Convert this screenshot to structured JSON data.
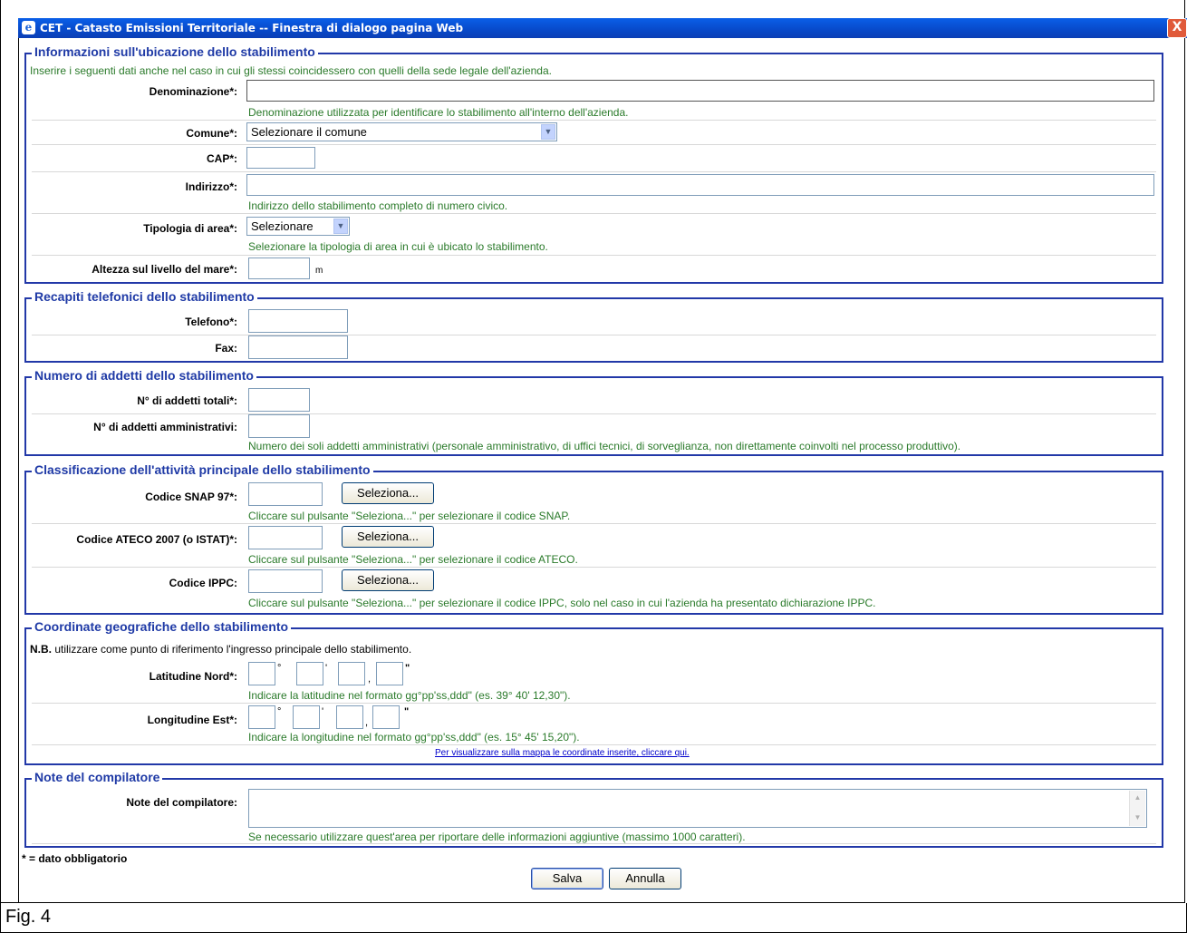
{
  "window": {
    "title": "CET - Catasto Emissioni Territoriale -- Finestra di dialogo pagina Web",
    "close_glyph": "X",
    "ie_glyph": "e"
  },
  "sec1": {
    "legend": "Informazioni sull'ubicazione dello stabilimento",
    "intro": "Inserire i seguenti dati anche nel caso in cui gli stessi coincidessero con quelli della sede legale dell'azienda.",
    "denominazione_label": "Denominazione*:",
    "denominazione_hint": "Denominazione utilizzata per identificare lo stabilimento all'interno dell'azienda.",
    "comune_label": "Comune*:",
    "comune_value": "Selezionare il comune",
    "cap_label": "CAP*:",
    "indirizzo_label": "Indirizzo*:",
    "indirizzo_hint": "Indirizzo dello stabilimento completo di numero civico.",
    "tipologia_label": "Tipologia di area*:",
    "tipologia_value": "Selezionare",
    "tipologia_hint": "Selezionare la tipologia di area in cui è ubicato lo stabilimento.",
    "altezza_label": "Altezza sul livello del mare*:",
    "altezza_unit": "m"
  },
  "sec2": {
    "legend": "Recapiti telefonici dello stabilimento",
    "telefono_label": "Telefono*:",
    "fax_label": "Fax:"
  },
  "sec3": {
    "legend": "Numero di addetti dello stabilimento",
    "totali_label": "N° di addetti totali*:",
    "amm_label": "N° di addetti amministrativi:",
    "amm_hint": "Numero dei soli addetti amministrativi (personale amministrativo, di uffici tecnici, di sorveglianza, non direttamente coinvolti nel processo produttivo)."
  },
  "sec4": {
    "legend": "Classificazione dell'attività principale dello stabilimento",
    "snap_label": "Codice SNAP 97*:",
    "snap_hint": "Cliccare sul pulsante \"Seleziona...\" per selezionare il codice SNAP.",
    "ateco_label": "Codice ATECO 2007 (o ISTAT)*:",
    "ateco_hint": "Cliccare sul pulsante \"Seleziona...\" per selezionare il codice ATECO.",
    "ippc_label": "Codice IPPC:",
    "ippc_hint": "Cliccare sul pulsante \"Seleziona...\" per selezionare il codice IPPC, solo nel caso in cui l'azienda ha presentato dichiarazione IPPC.",
    "button_label": "Seleziona..."
  },
  "sec5": {
    "legend": "Coordinate geografiche dello stabilimento",
    "nb_bold": "N.B.",
    "nb_text": " utilizzare come punto di riferimento l'ingresso principale dello stabilimento.",
    "lat_label": "Latitudine Nord*:",
    "lat_hint": "Indicare la latitudine nel formato gg°pp'ss,ddd\" (es. 39° 40' 12,30\").",
    "lon_label": "Longitudine Est*:",
    "lon_hint": "Indicare la longitudine nel formato gg°pp'ss,ddd\" (es. 15° 45' 15,20\").",
    "deg": "°",
    "min": "'",
    "comma": ",",
    "sec": "\"",
    "map_link": "Per visualizzare sulla mappa le coordinate inserite, cliccare qui."
  },
  "sec6": {
    "legend": "Note del compilatore",
    "note_label": "Note del compilatore:",
    "note_hint": "Se necessario utilizzare quest'area per riportare delle informazioni aggiuntive (massimo 1000 caratteri)."
  },
  "footer": {
    "required_note": "* = dato obbligatorio",
    "save_label": "Salva",
    "cancel_label": "Annulla",
    "caption": "Fig. 4"
  }
}
